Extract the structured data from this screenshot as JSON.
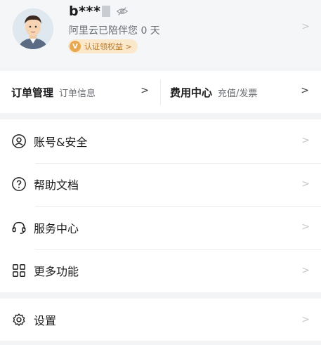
{
  "profile": {
    "username": "b***",
    "subtitle": "阿里云已陪伴您 0 天",
    "badge_text": "认证领权益 >",
    "badge_icon_letter": "V"
  },
  "quick_links": [
    {
      "title": "订单管理",
      "subtitle": "订单信息"
    },
    {
      "title": "费用中心",
      "subtitle": "充值/发票"
    }
  ],
  "menu": [
    {
      "label": "账号&安全",
      "icon": "user-circle-icon"
    },
    {
      "label": "帮助文档",
      "icon": "question-circle-icon"
    },
    {
      "label": "服务中心",
      "icon": "headset-icon"
    },
    {
      "label": "更多功能",
      "icon": "grid-icon"
    }
  ],
  "settings": {
    "label": "设置",
    "icon": "gear-icon"
  },
  "colors": {
    "accent": "#e9a84f",
    "badge_bg": "#fbe7c9",
    "muted": "#6a6d73"
  }
}
